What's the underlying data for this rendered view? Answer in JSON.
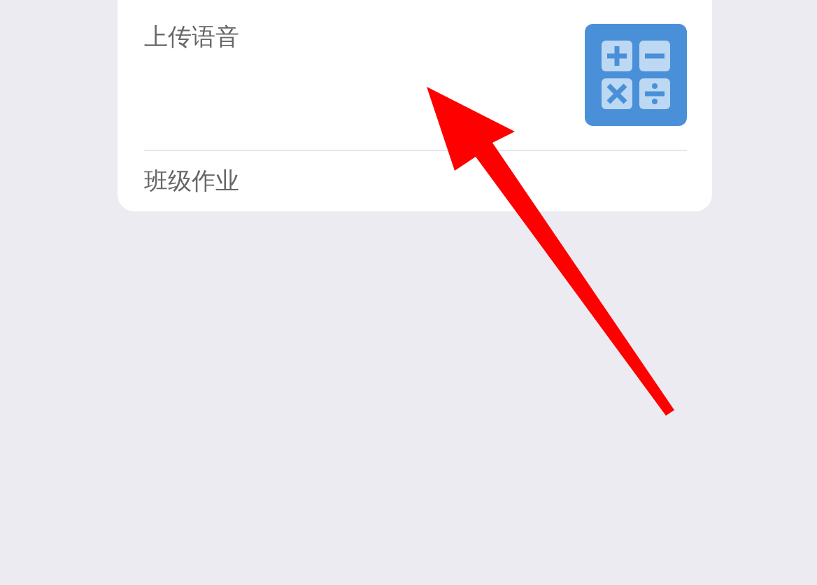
{
  "card": {
    "title": "上传语音",
    "footer": "班级作业"
  }
}
